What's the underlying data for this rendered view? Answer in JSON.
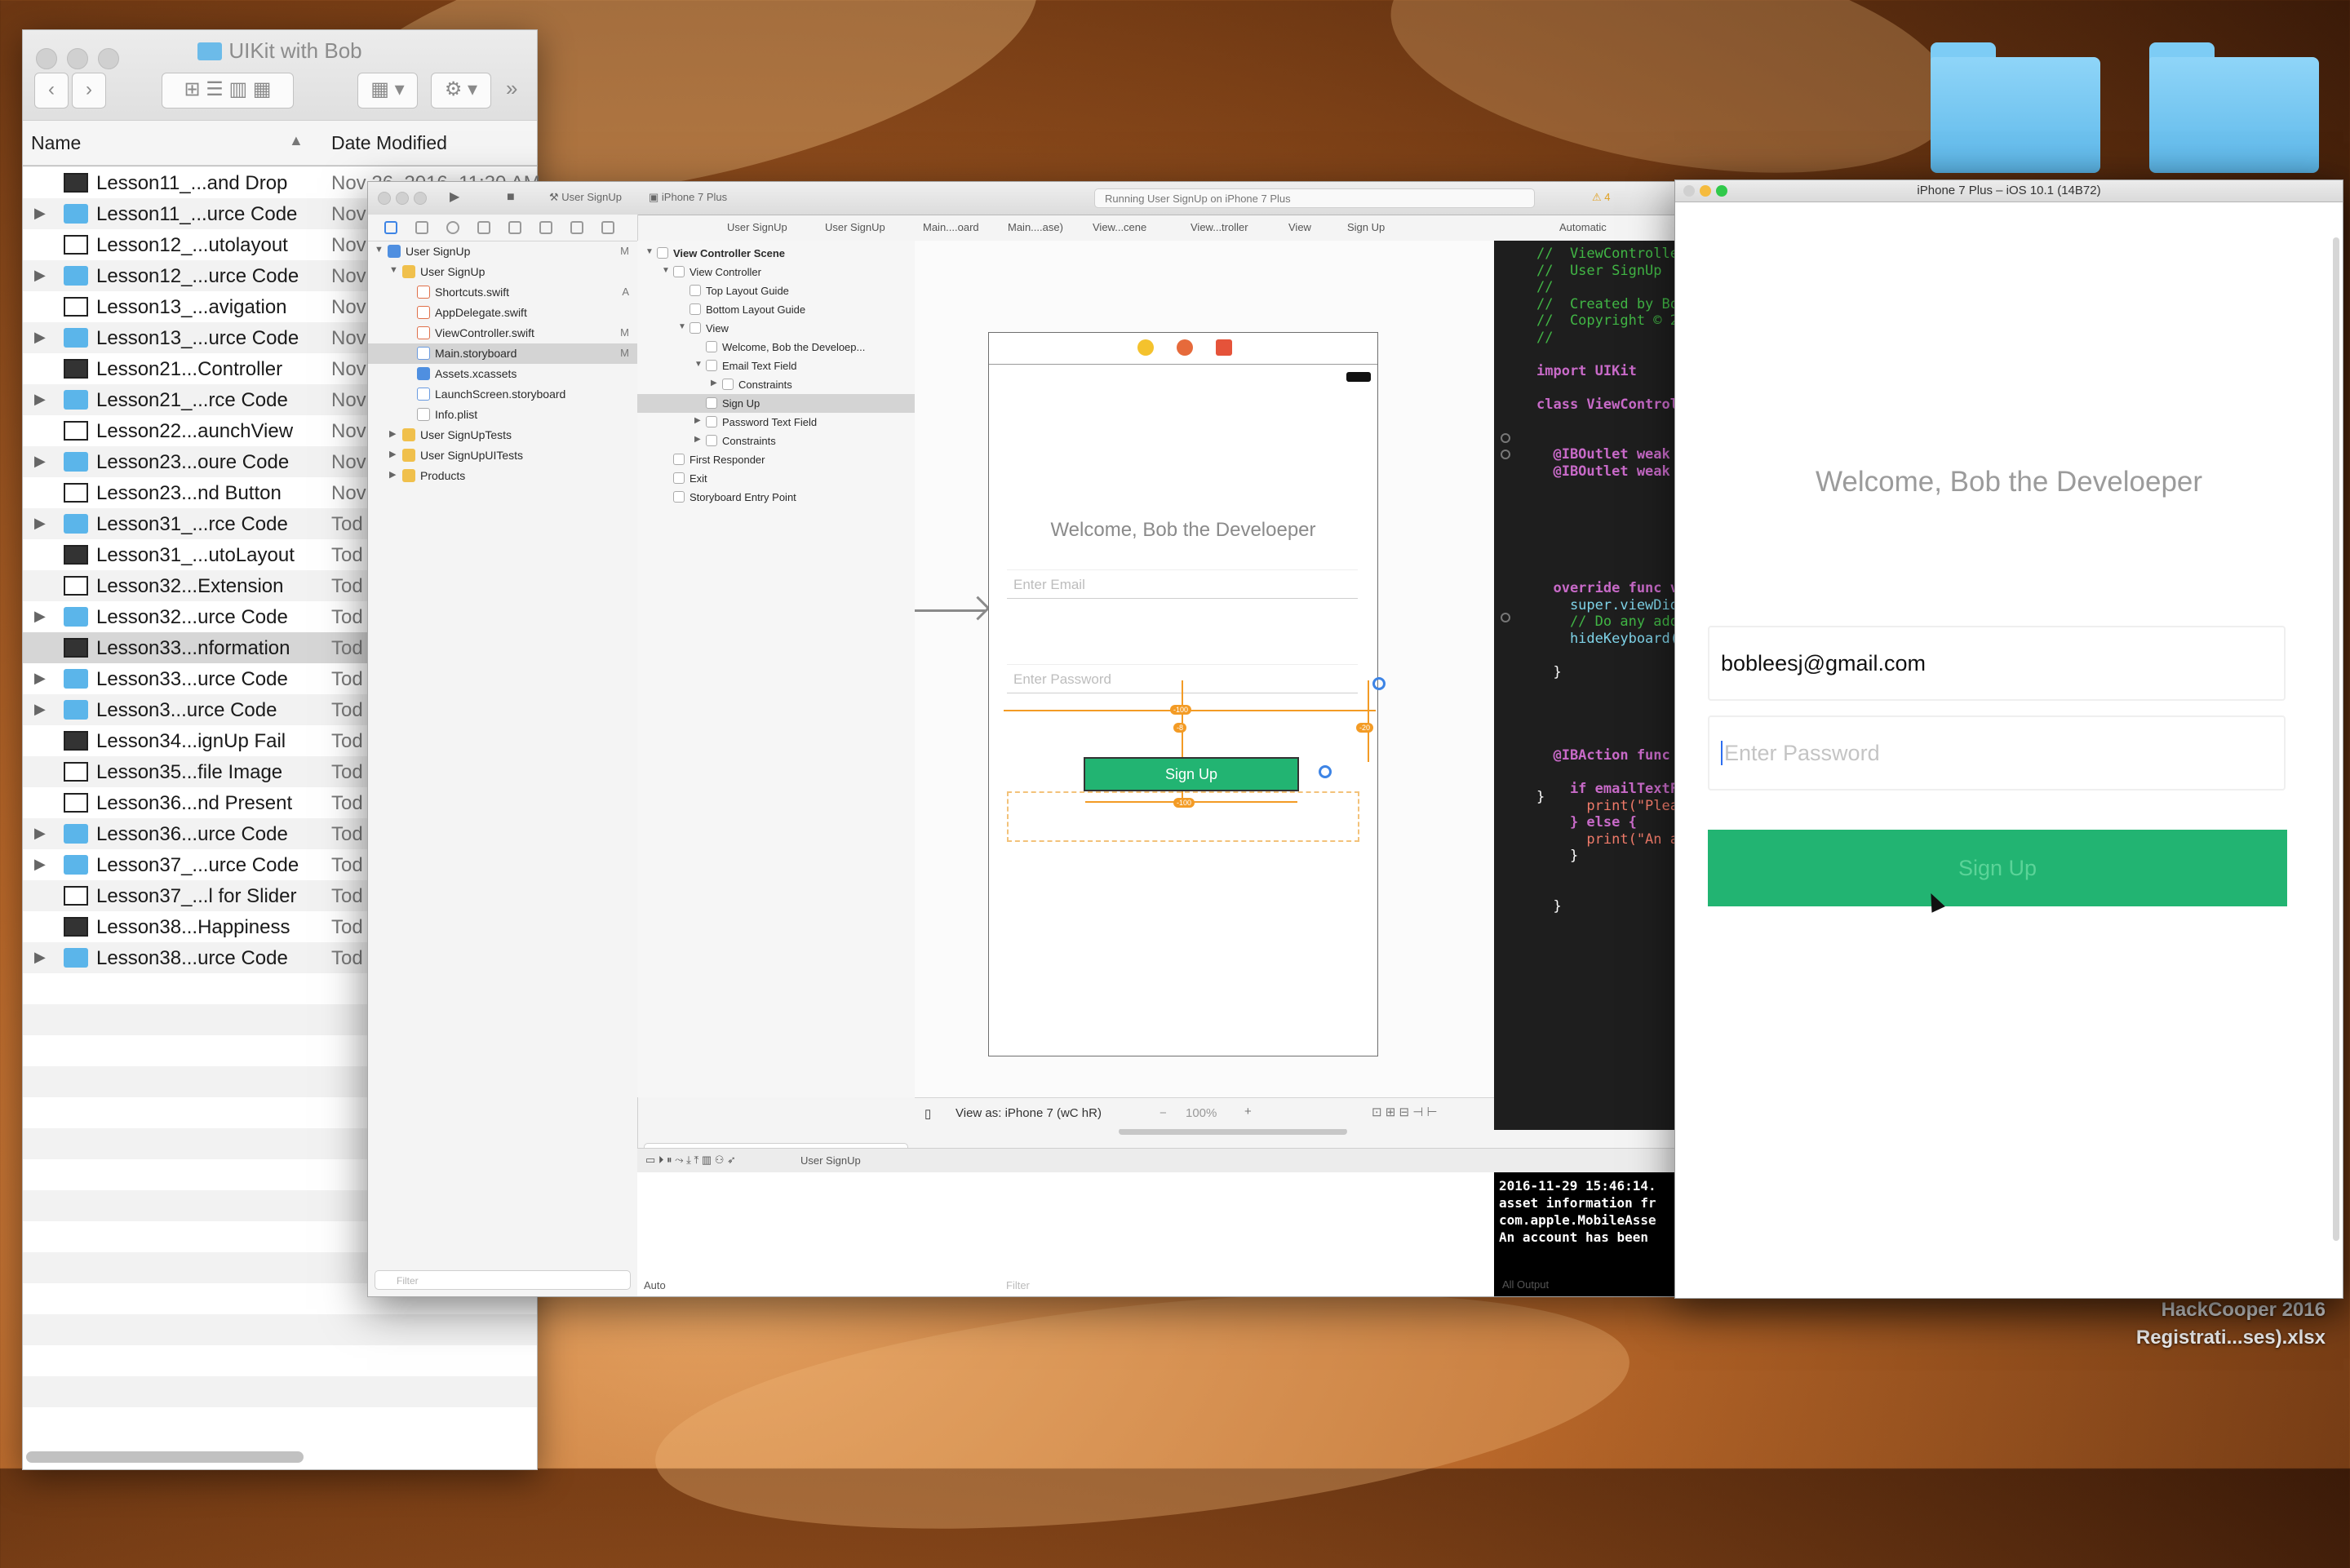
{
  "finder": {
    "title": "UIKit with Bob",
    "columns": {
      "name": "Name",
      "date": "Date Modified"
    },
    "rows": [
      {
        "name": "Lesson11_...and Drop",
        "date": "Nov 26, 2016, 11:30 AM",
        "type": "doc",
        "expandable": false,
        "selected": false
      },
      {
        "name": "Lesson11_...urce Code",
        "date": "Nov",
        "type": "folder",
        "expandable": true,
        "selected": false
      },
      {
        "name": "Lesson12_...utolayout",
        "date": "Nov",
        "type": "doc",
        "expandable": false,
        "selected": false
      },
      {
        "name": "Lesson12_...urce Code",
        "date": "Nov",
        "type": "folder",
        "expandable": true,
        "selected": false
      },
      {
        "name": "Lesson13_...avigation",
        "date": "Nov",
        "type": "doc",
        "expandable": false,
        "selected": false
      },
      {
        "name": "Lesson13_...urce Code",
        "date": "Nov",
        "type": "folder",
        "expandable": true,
        "selected": false
      },
      {
        "name": "Lesson21...Controller",
        "date": "Nov",
        "type": "doc",
        "expandable": false,
        "selected": false
      },
      {
        "name": "Lesson21_...rce Code",
        "date": "Nov",
        "type": "folder",
        "expandable": true,
        "selected": false
      },
      {
        "name": "Lesson22...aunchView",
        "date": "Nov",
        "type": "doc",
        "expandable": false,
        "selected": false
      },
      {
        "name": "Lesson23...oure Code",
        "date": "Nov",
        "type": "folder",
        "expandable": true,
        "selected": false
      },
      {
        "name": "Lesson23...nd Button",
        "date": "Nov",
        "type": "doc",
        "expandable": false,
        "selected": false
      },
      {
        "name": "Lesson31_...rce Code",
        "date": "Tod",
        "type": "folder",
        "expandable": true,
        "selected": false
      },
      {
        "name": "Lesson31_...utoLayout",
        "date": "Tod",
        "type": "doc",
        "expandable": false,
        "selected": false
      },
      {
        "name": "Lesson32...Extension",
        "date": "Tod",
        "type": "doc",
        "expandable": false,
        "selected": false
      },
      {
        "name": "Lesson32...urce Code",
        "date": "Tod",
        "type": "folder",
        "expandable": true,
        "selected": false
      },
      {
        "name": "Lesson33...nformation",
        "date": "Tod",
        "type": "doc",
        "expandable": false,
        "selected": true
      },
      {
        "name": "Lesson33...urce Code",
        "date": "Tod",
        "type": "folder",
        "expandable": true,
        "selected": false
      },
      {
        "name": "Lesson3...urce Code",
        "date": "Tod",
        "type": "folder",
        "expandable": true,
        "selected": false
      },
      {
        "name": "Lesson34...ignUp Fail",
        "date": "Tod",
        "type": "doc",
        "expandable": false,
        "selected": false
      },
      {
        "name": "Lesson35...file Image",
        "date": "Tod",
        "type": "doc",
        "expandable": false,
        "selected": false
      },
      {
        "name": "Lesson36...nd Present",
        "date": "Tod",
        "type": "doc",
        "expandable": false,
        "selected": false
      },
      {
        "name": "Lesson36...urce Code",
        "date": "Tod",
        "type": "folder",
        "expandable": true,
        "selected": false
      },
      {
        "name": "Lesson37_...urce Code",
        "date": "Tod",
        "type": "folder",
        "expandable": true,
        "selected": false
      },
      {
        "name": "Lesson37_...l for Slider",
        "date": "Tod",
        "type": "doc",
        "expandable": false,
        "selected": false
      },
      {
        "name": "Lesson38...Happiness",
        "date": "Tod",
        "type": "doc",
        "expandable": false,
        "selected": false
      },
      {
        "name": "Lesson38...urce Code",
        "date": "Tod",
        "type": "folder",
        "expandable": true,
        "selected": false
      }
    ]
  },
  "desktop": {
    "labels": [
      "HackCooper 2016",
      "Registrati...ses).xlsx"
    ]
  },
  "xcode": {
    "toolbar": {
      "scheme": "User SignUp",
      "device": "iPhone 7 Plus",
      "activity": "Running User SignUp on iPhone 7 Plus",
      "warnings": "4"
    },
    "navigator": [
      {
        "label": "User SignUp",
        "indent": 0,
        "glyph": "blue",
        "disclosure": "open",
        "badge": "M",
        "selected": false
      },
      {
        "label": "User SignUp",
        "indent": 1,
        "glyph": "folder",
        "disclosure": "open",
        "badge": "",
        "selected": false
      },
      {
        "label": "Shortcuts.swift",
        "indent": 2,
        "glyph": "swift",
        "disclosure": "",
        "badge": "A",
        "selected": false
      },
      {
        "label": "AppDelegate.swift",
        "indent": 2,
        "glyph": "swift",
        "disclosure": "",
        "badge": "",
        "selected": false
      },
      {
        "label": "ViewController.swift",
        "indent": 2,
        "glyph": "swift",
        "disclosure": "",
        "badge": "M",
        "selected": false
      },
      {
        "label": "Main.storyboard",
        "indent": 2,
        "glyph": "story",
        "disclosure": "",
        "badge": "M",
        "selected": true
      },
      {
        "label": "Assets.xcassets",
        "indent": 2,
        "glyph": "blue",
        "disclosure": "",
        "badge": "",
        "selected": false
      },
      {
        "label": "LaunchScreen.storyboard",
        "indent": 2,
        "glyph": "story",
        "disclosure": "",
        "badge": "",
        "selected": false
      },
      {
        "label": "Info.plist",
        "indent": 2,
        "glyph": "file",
        "disclosure": "",
        "badge": "",
        "selected": false
      },
      {
        "label": "User SignUpTests",
        "indent": 1,
        "glyph": "folder",
        "disclosure": "closed",
        "badge": "",
        "selected": false
      },
      {
        "label": "User SignUpUITests",
        "indent": 1,
        "glyph": "folder",
        "disclosure": "closed",
        "badge": "",
        "selected": false
      },
      {
        "label": "Products",
        "indent": 1,
        "glyph": "folder",
        "disclosure": "closed",
        "badge": "",
        "selected": false
      }
    ],
    "nav_filter": "Filter",
    "jumpbar": [
      "User SignUp",
      "User SignUp",
      "Main....oard",
      "Main....ase)",
      "View...cene",
      "View...troller",
      "View",
      "Sign Up"
    ],
    "assistant_mode": "Automatic",
    "outline": [
      {
        "label": "View Controller Scene",
        "indent": 0,
        "disclosure": "open",
        "bold": true,
        "selected": false
      },
      {
        "label": "View Controller",
        "indent": 1,
        "disclosure": "open",
        "bold": false,
        "selected": false
      },
      {
        "label": "Top Layout Guide",
        "indent": 2,
        "disclosure": "",
        "bold": false,
        "selected": false
      },
      {
        "label": "Bottom Layout Guide",
        "indent": 2,
        "disclosure": "",
        "bold": false,
        "selected": false
      },
      {
        "label": "View",
        "indent": 2,
        "disclosure": "open",
        "bold": false,
        "selected": false
      },
      {
        "label": "Welcome, Bob the Develoep...",
        "indent": 3,
        "disclosure": "",
        "bold": false,
        "selected": false
      },
      {
        "label": "Email Text Field",
        "indent": 3,
        "disclosure": "open",
        "bold": false,
        "selected": false
      },
      {
        "label": "Constraints",
        "indent": 4,
        "disclosure": "closed",
        "bold": false,
        "selected": false
      },
      {
        "label": "Sign Up",
        "indent": 3,
        "disclosure": "",
        "bold": false,
        "selected": true
      },
      {
        "label": "Password Text Field",
        "indent": 3,
        "disclosure": "closed",
        "bold": false,
        "selected": false
      },
      {
        "label": "Constraints",
        "indent": 3,
        "disclosure": "closed",
        "bold": false,
        "selected": false
      },
      {
        "label": "First Responder",
        "indent": 1,
        "disclosure": "",
        "bold": false,
        "selected": false
      },
      {
        "label": "Exit",
        "indent": 1,
        "disclosure": "",
        "bold": false,
        "selected": false
      },
      {
        "label": "Storyboard Entry Point",
        "indent": 1,
        "disclosure": "",
        "bold": false,
        "selected": false
      }
    ],
    "outline_filter": "Filter",
    "canvas": {
      "welcome": "Welcome, Bob the Develoeper",
      "email_placeholder": "Enter Email",
      "password_placeholder": "Enter Password",
      "button": "Sign Up",
      "view_as": "View as: iPhone 7 (wC hR)",
      "zoom": "100%"
    },
    "code": [
      {
        "text": "//  ViewControlle",
        "cls": "c-comment"
      },
      {
        "text": "//  User SignUp",
        "cls": "c-comment"
      },
      {
        "text": "//",
        "cls": "c-comment"
      },
      {
        "text": "//  Created by Bo",
        "cls": "c-comment"
      },
      {
        "text": "//  Copyright © 2",
        "cls": "c-comment"
      },
      {
        "text": "//",
        "cls": "c-comment"
      },
      {
        "text": "",
        "cls": ""
      },
      {
        "text": "import UIKit",
        "cls": "c-kw"
      },
      {
        "text": "",
        "cls": ""
      },
      {
        "text": "class ViewControl",
        "cls": "c-kw"
      },
      {
        "text": "",
        "cls": ""
      },
      {
        "text": "",
        "cls": ""
      },
      {
        "text": "  @IBOutlet weak",
        "cls": "c-kw"
      },
      {
        "text": "  @IBOutlet weak",
        "cls": "c-kw"
      },
      {
        "text": "",
        "cls": ""
      },
      {
        "text": "",
        "cls": ""
      },
      {
        "text": "",
        "cls": ""
      },
      {
        "text": "",
        "cls": ""
      },
      {
        "text": "",
        "cls": ""
      },
      {
        "text": "",
        "cls": ""
      },
      {
        "text": "  override func v",
        "cls": "c-kw"
      },
      {
        "text": "    super.viewDid",
        "cls": "c-fn"
      },
      {
        "text": "    // Do any add",
        "cls": "c-comment"
      },
      {
        "text": "    hideKeyboard(",
        "cls": "c-fn"
      },
      {
        "text": "",
        "cls": ""
      },
      {
        "text": "  }",
        "cls": "c-type"
      },
      {
        "text": "",
        "cls": ""
      },
      {
        "text": "",
        "cls": ""
      },
      {
        "text": "",
        "cls": ""
      },
      {
        "text": "",
        "cls": ""
      },
      {
        "text": "  @IBAction func",
        "cls": "c-kw"
      },
      {
        "text": "",
        "cls": ""
      },
      {
        "text": "    if emailTextF",
        "cls": "c-kw"
      },
      {
        "text": "      print(\"Plea",
        "cls": "c-str"
      },
      {
        "text": "    } else {",
        "cls": "c-kw"
      },
      {
        "text": "      print(\"An a",
        "cls": "c-str"
      },
      {
        "text": "    }",
        "cls": "c-type"
      },
      {
        "text": "",
        "cls": ""
      },
      {
        "text": "",
        "cls": ""
      },
      {
        "text": "  }",
        "cls": "c-type"
      }
    ],
    "closing_brace": "}",
    "console": [
      "2016-11-29 15:46:14.",
      "asset information fr",
      "com.apple.MobileAsse",
      "An account has been"
    ],
    "debug_breadcrumb": "User SignUp",
    "variables_mode": "Auto",
    "console_filter": "Filter",
    "output_mode": "All Output"
  },
  "simulator": {
    "title": "iPhone 7 Plus – iOS 10.1 (14B72)",
    "welcome": "Welcome, Bob the Develoeper",
    "email_value": "bobleesj@gmail.com",
    "password_placeholder": "Enter Password",
    "button": "Sign Up",
    "button_color": "#22b472"
  }
}
